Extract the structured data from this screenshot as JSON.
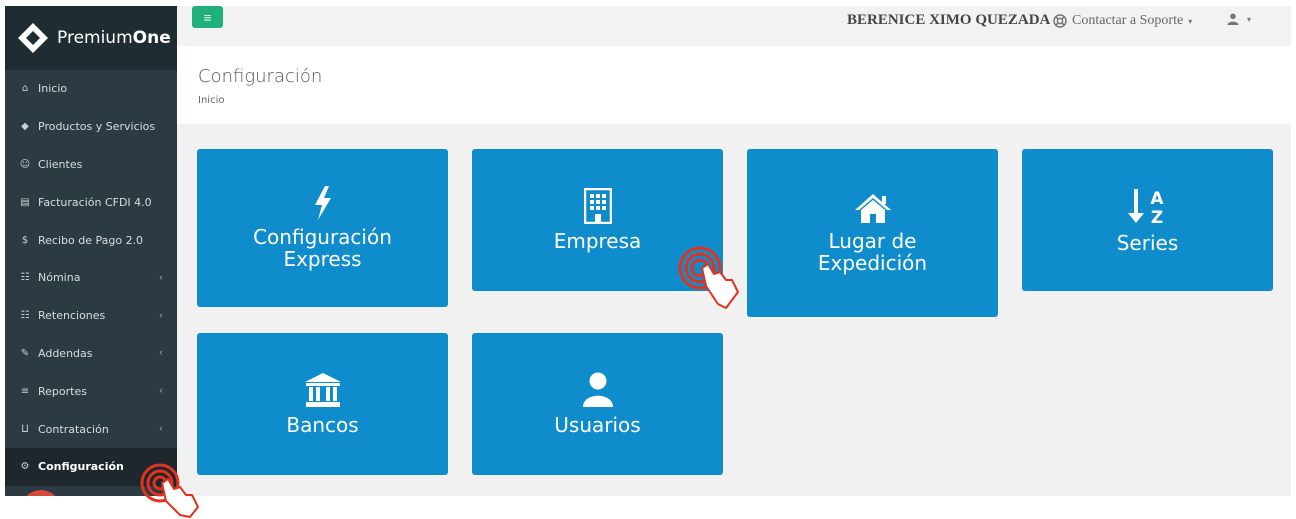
{
  "app": {
    "logo_light": "Premium",
    "logo_bold": "One"
  },
  "sidebar": {
    "items": [
      {
        "label": "Inicio",
        "icon": "home-icon",
        "glyph": "⌂",
        "has_children": false
      },
      {
        "label": "Productos y Servicios",
        "icon": "tag-icon",
        "glyph": "◆",
        "has_children": false
      },
      {
        "label": "Clientes",
        "icon": "users-icon",
        "glyph": "☺",
        "has_children": false
      },
      {
        "label": "Facturación CFDI 4.0",
        "icon": "file-icon",
        "glyph": "▤",
        "has_children": false
      },
      {
        "label": "Recibo de Pago 2.0",
        "icon": "dollar-icon",
        "glyph": "$",
        "has_children": false
      },
      {
        "label": "Nómina",
        "icon": "sitemap-icon",
        "glyph": "☷",
        "has_children": true
      },
      {
        "label": "Retenciones",
        "icon": "sitemap-icon",
        "glyph": "☷",
        "has_children": true
      },
      {
        "label": "Addendas",
        "icon": "paperclip-icon",
        "glyph": "✎",
        "has_children": true
      },
      {
        "label": "Reportes",
        "icon": "list-icon",
        "glyph": "≡",
        "has_children": true
      },
      {
        "label": "Contratación",
        "icon": "cart-icon",
        "glyph": "⨿",
        "has_children": true
      },
      {
        "label": "Configuración",
        "icon": "gears-icon",
        "glyph": "⚙",
        "has_children": false,
        "active": true
      }
    ]
  },
  "topbar": {
    "menu_glyph": "≡",
    "user_name": "BERENICE XIMO QUEZADA",
    "support_label": "Contactar a Soporte",
    "caret": "▾"
  },
  "header": {
    "title": "Configuración",
    "breadcrumb": "Inicio"
  },
  "tiles": [
    {
      "label": "Configuración\nExpress",
      "icon": "bolt-icon"
    },
    {
      "label": "Empresa",
      "icon": "building-icon"
    },
    {
      "label": "Lugar de\nExpedición",
      "icon": "home-icon"
    },
    {
      "label": "Series",
      "icon": "sort-alpha-icon",
      "icon_text_top": "A",
      "icon_text_bottom": "Z"
    },
    {
      "label": "Bancos",
      "icon": "bank-icon"
    },
    {
      "label": "Usuarios",
      "icon": "user-icon"
    }
  ],
  "colors": {
    "sidebar_bg": "#2c3b41",
    "tile_bg": "#0f8ccc",
    "menu_button": "#20b07a",
    "pointer_red": "#e0321f"
  }
}
